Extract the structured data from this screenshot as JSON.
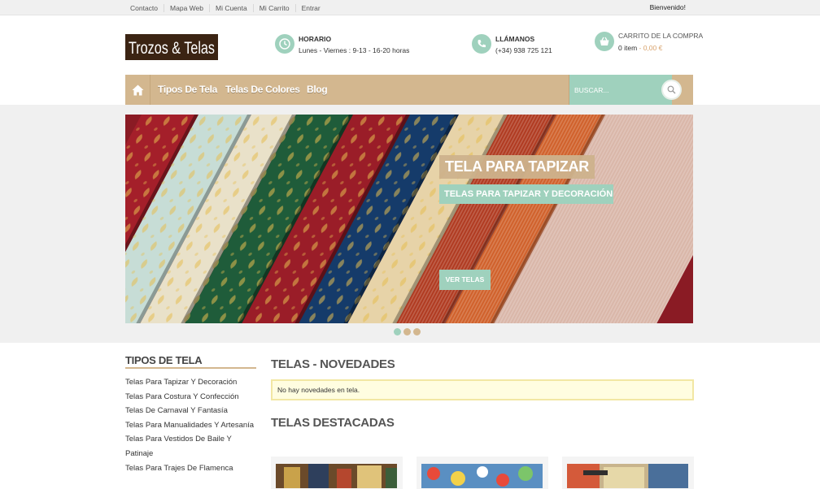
{
  "topbar": {
    "links": [
      "Contacto",
      "Mapa Web",
      "Mi Cuenta",
      "Mi Carrito",
      "Entrar"
    ],
    "welcome": "Bienvenido!"
  },
  "header": {
    "logo_text": "Trozos & Telas",
    "schedule": {
      "title": "HORARIO",
      "value": "Lunes - Viernes : 9-13 - 16-20 horas",
      "icon": "clock-icon"
    },
    "phone": {
      "title": "LLÁMANOS",
      "value": "(+34) 938 725 121",
      "icon": "phone-icon"
    },
    "cart": {
      "title": "CARRITO DE LA COMPRA",
      "items": "0 item",
      "separator": " - ",
      "price": "0,00 €",
      "icon": "basket-icon"
    }
  },
  "nav": {
    "home_icon": "home-icon",
    "items": [
      "Tipos De Tela",
      "Telas De Colores",
      "Blog"
    ],
    "search_placeholder": "BUSCAR...",
    "search_icon": "magnifier-icon"
  },
  "slider": {
    "caption_title": "TELA PARA TAPIZAR",
    "caption_subtitle": "TELAS PARA TAPIZAR Y DECORACIÓN",
    "button_label": "VER TELAS",
    "slide_count": 3,
    "active_slide": 1
  },
  "sidebar": {
    "title": "TIPOS DE TELA",
    "items": [
      "Telas Para Tapizar Y Decoración",
      "Telas Para Costura Y Confección",
      "Telas De Carnaval Y Fantasía",
      "Telas Para Manualidades Y Artesanía",
      "Telas Para Vestidos De Baile Y Patinaje",
      "Telas Para Trajes De Flamenca"
    ]
  },
  "main": {
    "news_title": "TELAS - NOVEDADES",
    "news_notice": "No hay novedades en tela.",
    "featured_title": "TELAS DESTACADAS"
  },
  "colors": {
    "accent_green": "#9fd1bd",
    "accent_tan": "#d3b78f",
    "logo_bg": "#3b2413",
    "price": "#d8a26b"
  }
}
